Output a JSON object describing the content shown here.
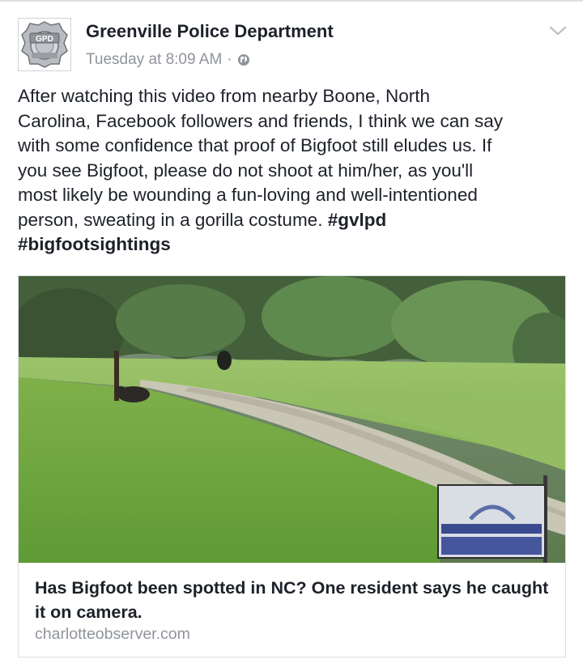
{
  "post": {
    "page_name": "Greenville Police Department",
    "timestamp": "Tuesday at 8:09 AM",
    "separator": "·",
    "privacy_icon": "globe-icon",
    "menu_icon": "chevron-down-icon",
    "avatar_badge_text": "GPD",
    "text": "After watching this video from nearby Boone, North\nCarolina, Facebook followers and friends, I think we can say\nwith some confidence that proof of Bigfoot still eludes us. If\nyou see Bigfoot, please do not shoot at him/her, as you'll\nmost likely be wounding a fun-loving and well-intentioned\nperson, sweating in a gorilla costume. ",
    "hashtag_1": "#gvlpd",
    "hashtag_2": "#bigfootsightings"
  },
  "link_card": {
    "title": "Has Bigfoot been spotted in NC? One resident says he caught it on camera.",
    "domain": "charlotteobserver.com"
  },
  "colors": {
    "text": "#1d2129",
    "meta": "#90949c",
    "border": "#dddfe2",
    "grass": "#6fa83f",
    "sign_blue": "#3a4a8f"
  }
}
